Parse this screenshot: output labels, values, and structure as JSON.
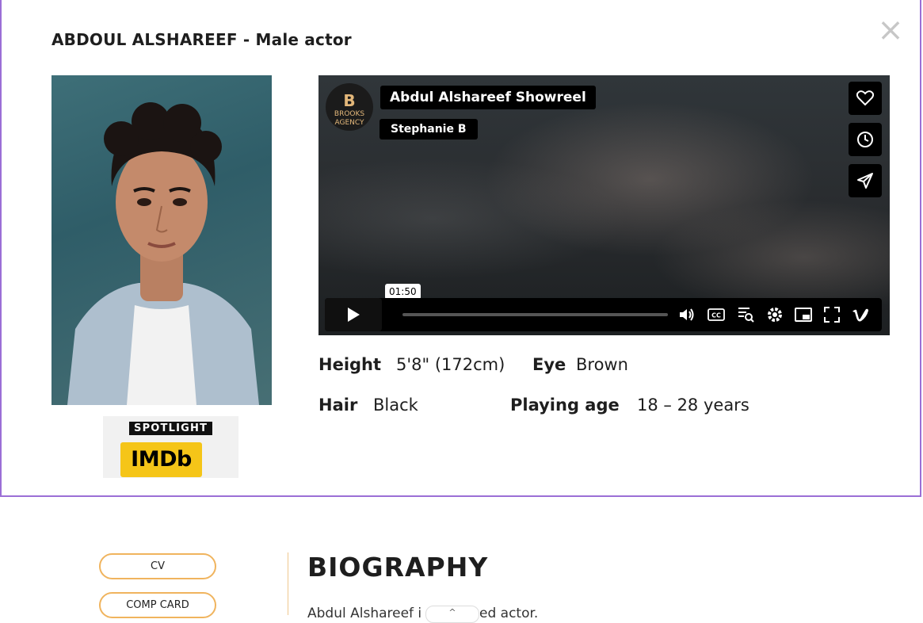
{
  "modal": {
    "title": "ABDOUL ALSHAREEF - Male actor",
    "close_label": "×"
  },
  "logos": {
    "spotlight": "SPOTLIGHT",
    "imdb": "IMDb"
  },
  "video": {
    "title": "Abdul Alshareef Showreel",
    "author": "Stephanie B",
    "channel_logo_text": "BROOKS AGENCY",
    "channel_logo_letter": "B",
    "time_tooltip": "01:50",
    "progress": 0.0
  },
  "attributes": {
    "height_label": "Height",
    "height_value": "5'8\" (172cm)",
    "eye_label": "Eye",
    "eye_value": "Brown",
    "hair_label": "Hair",
    "hair_value": "Black",
    "age_label": "Playing age",
    "age_value": "18 – 28 years"
  },
  "sidebar": {
    "cv_label": "CV",
    "comp_card_label": "COMP CARD"
  },
  "biography": {
    "title": "BIOGRAPHY",
    "text": "Abdul Alshareef i                  don based actor.",
    "scroll_label": "^"
  },
  "colors": {
    "accent_border": "#9b6fd6",
    "button_border": "#f0b45e",
    "imdb_yellow": "#f5c518"
  }
}
